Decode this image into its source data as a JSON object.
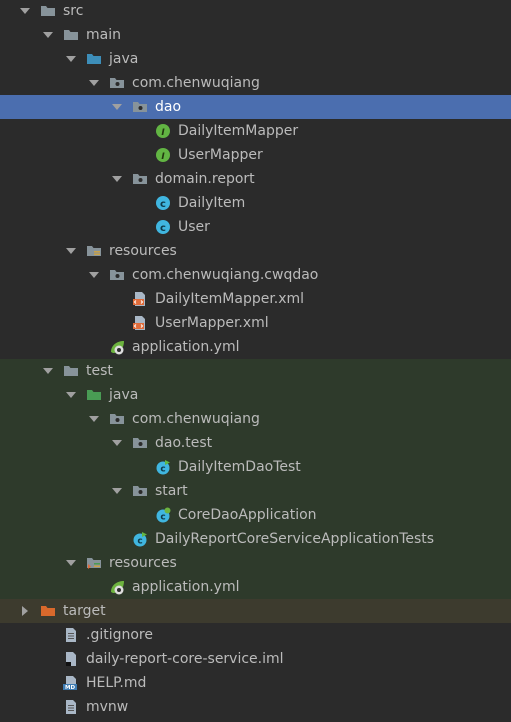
{
  "colors": {
    "background": "#2b2b2b",
    "test_background": "#2e3a2b",
    "selection": "#4b6eaf",
    "target_background": "#3d3b2e",
    "text": "#bbbbbb",
    "folder_grey": "#87939a",
    "source_blue": "#3d8eb9",
    "test_green": "#499c54",
    "interface_green": "#62b543",
    "class_blue": "#40b6e0",
    "xml_orange": "#e06c3b",
    "target_orange": "#d9692c",
    "spring_green": "#6db33f"
  },
  "tree": [
    {
      "label": "src",
      "icon": "folder-icon",
      "expanded": true
    },
    {
      "label": "main",
      "icon": "folder-icon",
      "expanded": true
    },
    {
      "label": "java",
      "icon": "source-folder-icon",
      "expanded": true
    },
    {
      "label": "com.chenwuqiang",
      "icon": "package-icon",
      "expanded": true
    },
    {
      "label": "dao",
      "icon": "package-icon",
      "expanded": true,
      "selected": true
    },
    {
      "label": "DailyItemMapper",
      "icon": "interface-icon"
    },
    {
      "label": "UserMapper",
      "icon": "interface-icon"
    },
    {
      "label": "domain.report",
      "icon": "package-icon",
      "expanded": true
    },
    {
      "label": "DailyItem",
      "icon": "class-icon"
    },
    {
      "label": "User",
      "icon": "class-icon"
    },
    {
      "label": "resources",
      "icon": "resources-folder-icon",
      "expanded": true
    },
    {
      "label": "com.chenwuqiang.cwqdao",
      "icon": "package-icon",
      "expanded": true
    },
    {
      "label": "DailyItemMapper.xml",
      "icon": "xml-file-icon"
    },
    {
      "label": "UserMapper.xml",
      "icon": "xml-file-icon"
    },
    {
      "label": "application.yml",
      "icon": "spring-config-icon"
    },
    {
      "label": "test",
      "icon": "folder-icon",
      "expanded": true
    },
    {
      "label": "java",
      "icon": "test-source-folder-icon",
      "expanded": true
    },
    {
      "label": "com.chenwuqiang",
      "icon": "package-icon",
      "expanded": true
    },
    {
      "label": "dao.test",
      "icon": "package-icon",
      "expanded": true
    },
    {
      "label": "DailyItemDaoTest",
      "icon": "test-class-icon"
    },
    {
      "label": "start",
      "icon": "package-icon",
      "expanded": true
    },
    {
      "label": "CoreDaoApplication",
      "icon": "spring-boot-class-icon"
    },
    {
      "label": "DailyReportCoreServiceApplicationTests",
      "icon": "test-class-icon"
    },
    {
      "label": "resources",
      "icon": "test-resources-folder-icon",
      "expanded": true
    },
    {
      "label": "application.yml",
      "icon": "spring-config-icon"
    },
    {
      "label": "target",
      "icon": "excluded-folder-icon",
      "expanded": false
    },
    {
      "label": ".gitignore",
      "icon": "text-file-icon"
    },
    {
      "label": "daily-report-core-service.iml",
      "icon": "iml-file-icon"
    },
    {
      "label": "HELP.md",
      "icon": "markdown-file-icon"
    },
    {
      "label": "mvnw",
      "icon": "text-file-icon"
    }
  ]
}
